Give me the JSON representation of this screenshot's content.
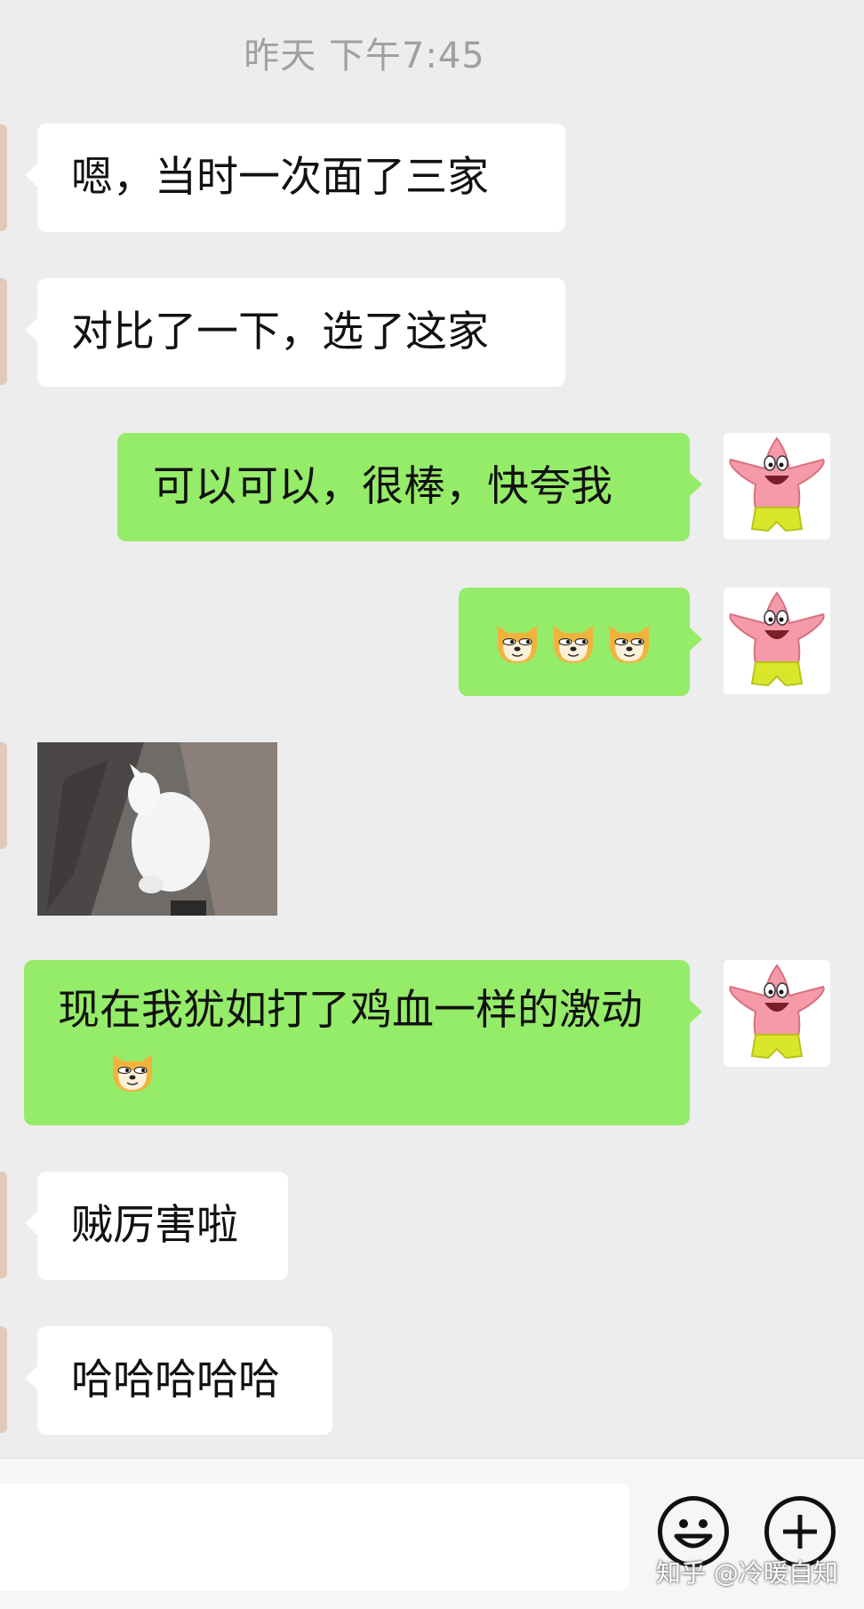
{
  "timestamp": "昨天 下午7:45",
  "messages": [
    {
      "text": "嗯，当时一次面了三家"
    },
    {
      "text": "对比了一下，选了这家"
    },
    {
      "text": "可以可以，很棒，快夸我"
    },
    {
      "emoji": "doge-emoji"
    },
    {
      "image": "white-cat-photo"
    },
    {
      "text": "现在我犹如打了鸡血一样的激动"
    },
    {
      "text": "贼厉害啦"
    },
    {
      "text": "哈哈哈哈哈"
    }
  ],
  "input": {
    "value": ""
  },
  "watermark": "知乎 @冷暖自知",
  "colors": {
    "incoming": "#ffffff",
    "outgoing": "#95ec69",
    "background": "#ededed"
  }
}
